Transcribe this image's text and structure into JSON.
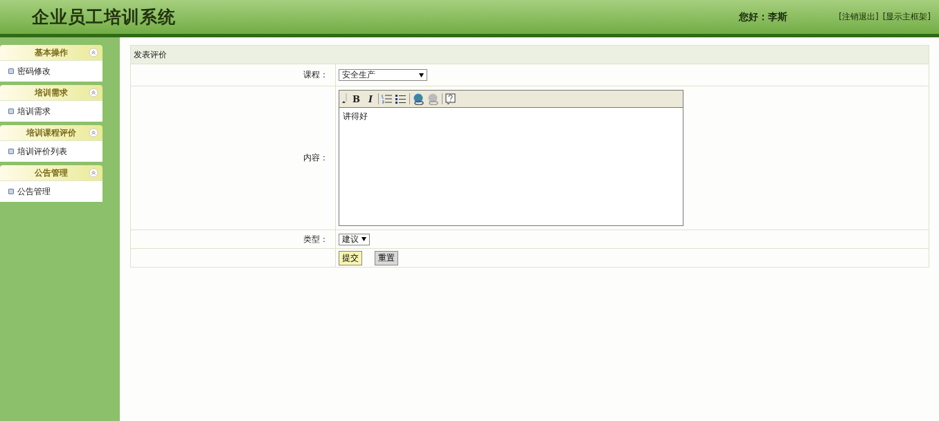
{
  "header": {
    "title": "企业员工培训系统",
    "greeting": "您好：李斯",
    "links": [
      "[注销退出]",
      "[显示主框架]"
    ]
  },
  "sidebar": {
    "sections": [
      {
        "title": "基本操作",
        "expanded": true,
        "items": [
          "密码修改"
        ]
      },
      {
        "title": "培训需求",
        "expanded": true,
        "items": [
          "培训需求"
        ]
      },
      {
        "title": "培训课程评价",
        "expanded": true,
        "items": [
          "培训评价列表"
        ]
      },
      {
        "title": "公告管理",
        "expanded": true,
        "items": [
          "公告管理"
        ]
      }
    ]
  },
  "form": {
    "title": "发表评价",
    "fields": [
      {
        "kind": "select",
        "label": "课程：",
        "value": "安全生产"
      },
      {
        "kind": "editor",
        "label": "内容：",
        "value": "讲得好",
        "toolbar": [
          {
            "kind": "grip"
          },
          {
            "kind": "bold",
            "label": "B"
          },
          {
            "kind": "italic",
            "label": "I"
          },
          {
            "kind": "separator"
          },
          {
            "kind": "ordered-list"
          },
          {
            "kind": "bullet-list"
          },
          {
            "kind": "separator"
          },
          {
            "kind": "link"
          },
          {
            "kind": "unlink"
          },
          {
            "kind": "separator"
          },
          {
            "kind": "help"
          }
        ]
      },
      {
        "kind": "select-small",
        "label": "类型：",
        "value": "建议"
      }
    ],
    "buttons": [
      {
        "label": "提交",
        "kind": "primary"
      },
      {
        "label": "重置",
        "kind": "secondary"
      }
    ]
  }
}
